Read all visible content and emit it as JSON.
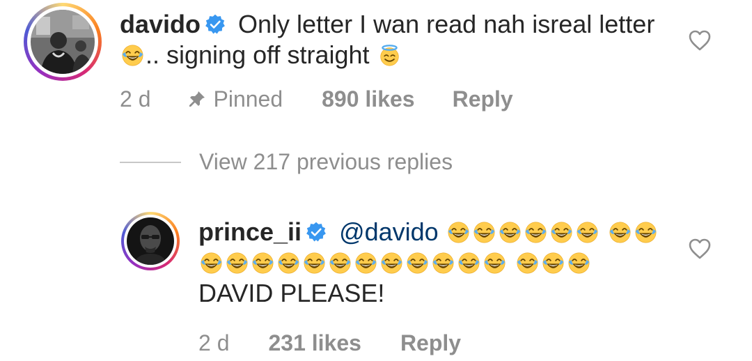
{
  "comment1": {
    "username": "davido",
    "text_part1": "Only letter I wan read nah isreal letter",
    "text_part2": ".. signing off straight",
    "time": "2 d",
    "pinned_label": "Pinned",
    "likes": "890 likes",
    "reply_label": "Reply"
  },
  "view_replies": {
    "label": "View 217 previous replies"
  },
  "comment2": {
    "username": "prince_ii",
    "mention": "@davido",
    "text": "DAVID PLEASE!",
    "time": "2 d",
    "likes": "231 likes",
    "reply_label": "Reply"
  },
  "icons": {
    "verified": "verified-badge-icon",
    "heart": "heart-outline-icon",
    "pin": "pin-icon",
    "laugh": "face-with-tears-of-joy-icon",
    "halo": "smiling-face-with-halo-icon"
  },
  "colors": {
    "verified": "#3897f0",
    "meta": "#8e8e8e",
    "mention": "#00376b",
    "text": "#262626"
  }
}
